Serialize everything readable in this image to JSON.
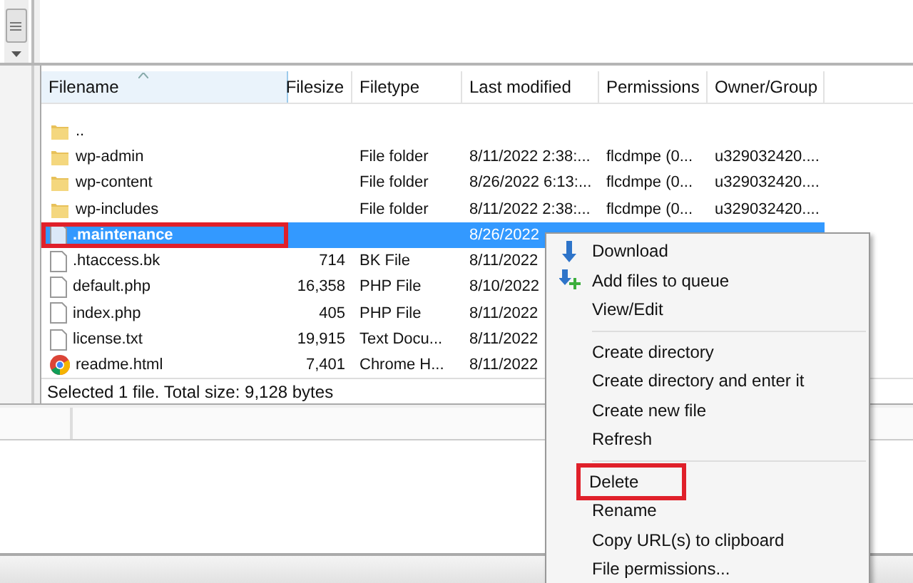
{
  "file_list": {
    "columns": [
      {
        "label": "Filename",
        "sorted": true
      },
      {
        "label": "Filesize",
        "sorted": false
      },
      {
        "label": "Filetype",
        "sorted": false
      },
      {
        "label": "Last modified",
        "sorted": false
      },
      {
        "label": "Permissions",
        "sorted": false
      },
      {
        "label": "Owner/Group",
        "sorted": false
      }
    ],
    "rows": [
      {
        "kind": "folder",
        "name": "..",
        "selected": false,
        "outlined": false
      },
      {
        "kind": "folder",
        "name": "wp-admin",
        "type": "File folder",
        "modified": "8/11/2022 2:38:...",
        "permissions": "flcdmpe (0...",
        "owner": "u329032420....",
        "selected": false,
        "outlined": false
      },
      {
        "kind": "folder",
        "name": "wp-content",
        "type": "File folder",
        "modified": "8/26/2022 6:13:...",
        "permissions": "flcdmpe (0...",
        "owner": "u329032420....",
        "selected": false,
        "outlined": false
      },
      {
        "kind": "folder",
        "name": "wp-includes",
        "type": "File folder",
        "modified": "8/11/2022 2:38:...",
        "permissions": "flcdmpe (0...",
        "owner": "u329032420....",
        "selected": false,
        "outlined": false
      },
      {
        "kind": "file",
        "name": ".maintenance",
        "modified": "8/26/2022",
        "selected": true,
        "outlined": true
      },
      {
        "kind": "file",
        "name": ".htaccess.bk",
        "size": "714",
        "type": "BK File",
        "modified": "8/11/2022",
        "selected": false,
        "outlined": false
      },
      {
        "kind": "file",
        "name": "default.php",
        "size": "16,358",
        "type": "PHP File",
        "modified": "8/10/2022",
        "selected": false,
        "outlined": false
      },
      {
        "kind": "file",
        "name": "index.php",
        "size": "405",
        "type": "PHP File",
        "modified": "8/11/2022",
        "selected": false,
        "outlined": false
      },
      {
        "kind": "file",
        "name": "license.txt",
        "size": "19,915",
        "type": "Text Docu...",
        "modified": "8/11/2022",
        "selected": false,
        "outlined": false
      },
      {
        "kind": "browser",
        "name": "readme.html",
        "size": "7,401",
        "type": "Chrome H...",
        "modified": "8/11/2022",
        "selected": false,
        "outlined": false
      }
    ],
    "status": "Selected 1 file. Total size: 9,128 bytes"
  },
  "context_menu": {
    "items": [
      {
        "kind": "item",
        "label": "Download",
        "outlined": false
      },
      {
        "kind": "item",
        "label": "Add files to queue",
        "outlined": false
      },
      {
        "kind": "item",
        "label": "View/Edit",
        "outlined": false
      },
      {
        "kind": "separator"
      },
      {
        "kind": "item",
        "label": "Create directory",
        "outlined": false
      },
      {
        "kind": "item",
        "label": "Create directory and enter it",
        "outlined": false
      },
      {
        "kind": "item",
        "label": "Create new file",
        "outlined": false
      },
      {
        "kind": "item",
        "label": "Refresh",
        "outlined": false
      },
      {
        "kind": "separator"
      },
      {
        "kind": "item",
        "label": "Delete",
        "outlined": true
      },
      {
        "kind": "item",
        "label": "Rename",
        "outlined": false
      },
      {
        "kind": "item",
        "label": "Copy URL(s) to clipboard",
        "outlined": false
      },
      {
        "kind": "item",
        "label": "File permissions...",
        "outlined": false
      }
    ]
  }
}
